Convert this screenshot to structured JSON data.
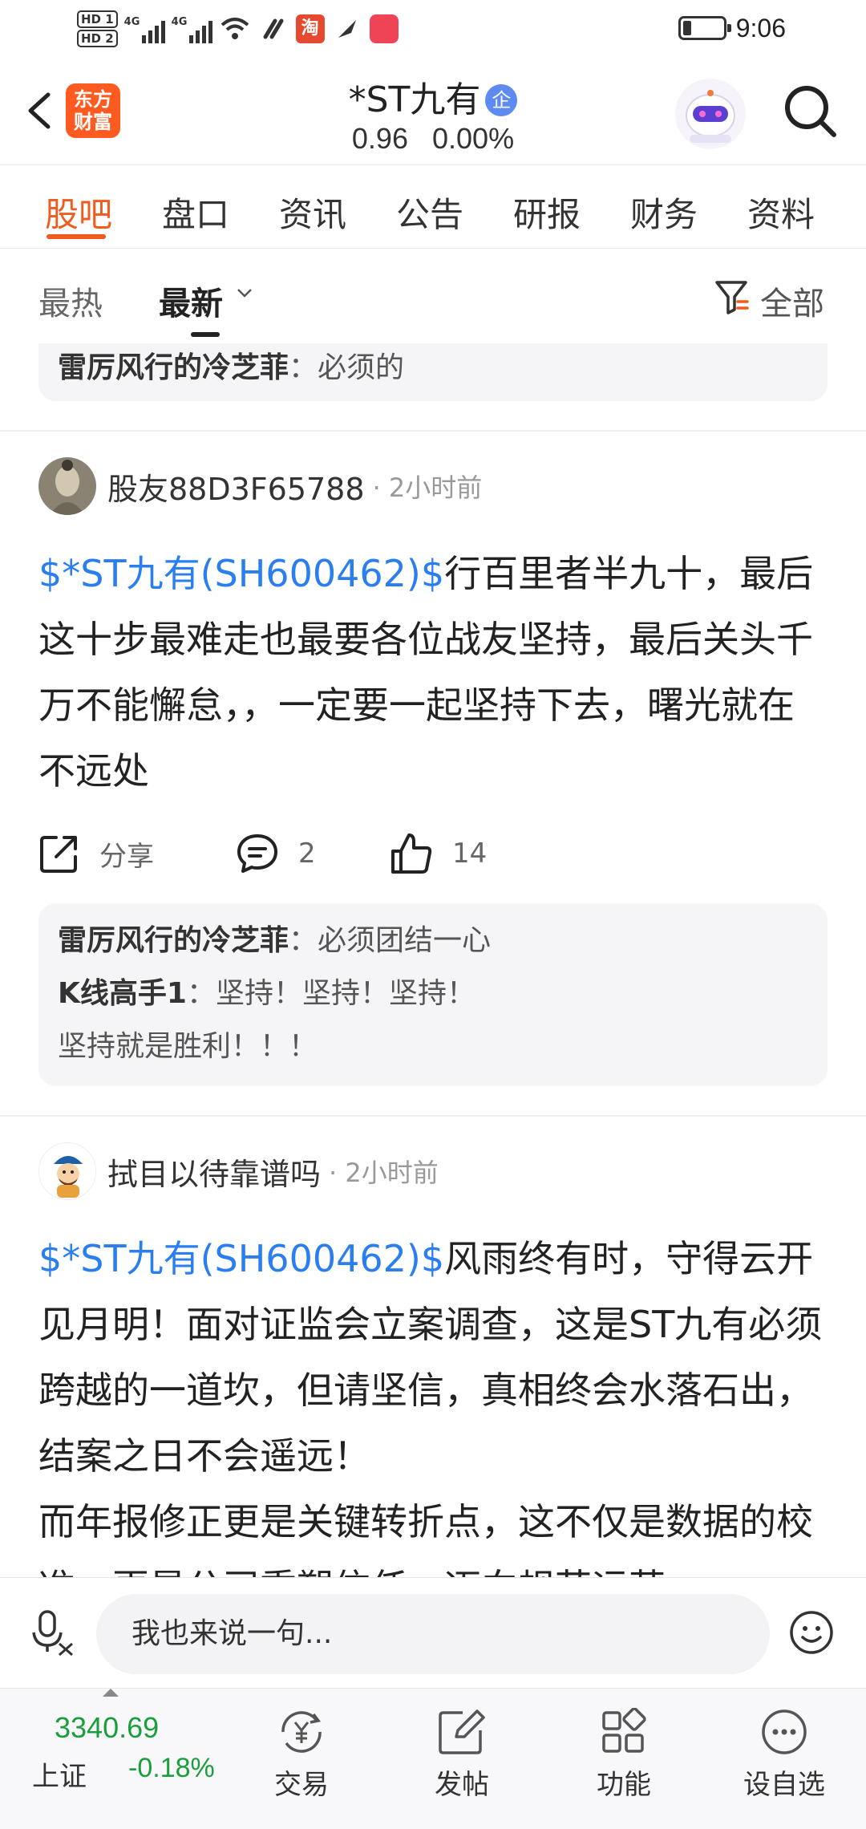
{
  "status_bar": {
    "time": "9:06",
    "hd1": "HD 1",
    "hd2": "HD 2",
    "network1": "4G",
    "network2": "4G",
    "taobao_icon_text": "淘"
  },
  "header": {
    "logo_text_line1": "东方",
    "logo_text_line2": "财富",
    "stock_name": "*ST九有",
    "badge": "企",
    "price": "0.96",
    "change_pct": "0.00%"
  },
  "tabs": [
    {
      "label": "股吧",
      "active": true
    },
    {
      "label": "盘口",
      "active": false
    },
    {
      "label": "资讯",
      "active": false
    },
    {
      "label": "公告",
      "active": false
    },
    {
      "label": "研报",
      "active": false
    },
    {
      "label": "财务",
      "active": false
    },
    {
      "label": "资料",
      "active": false
    }
  ],
  "sort": {
    "hot": "最热",
    "new": "最新",
    "filter_label": "全部"
  },
  "partial_reply": {
    "user": "雷厉风行的冷芝菲",
    "text": "：必须的"
  },
  "posts": [
    {
      "author": "股友88D3F65788",
      "time": "· 2小时前",
      "stock_link": "$*ST九有(SH600462)$",
      "body": "行百里者半九十，最后这十步最难走也最要各位战友坚持，最后关头千万不能懈怠，，一定要一起坚持下去，曙光就在不远处",
      "share_label": "分享",
      "comments": "2",
      "likes": "14",
      "replies": [
        {
          "user": "雷厉风行的冷芝菲",
          "text": "：必须团结一心"
        },
        {
          "user": "K线高手1",
          "text": "：坚持！坚持！坚持！"
        },
        {
          "user": "",
          "text": "坚持就是胜利！！！"
        }
      ]
    },
    {
      "author": "拭目以待靠谱吗",
      "time": "· 2小时前",
      "stock_link": "$*ST九有(SH600462)$",
      "body": "风雨终有时，守得云开见月明！面对证监会立案调查，这是ST九有必须跨越的一道坎，但请坚信，真相终会水落石出，结案之日不会遥远！",
      "body2": "而年报修正更是关键转折点，这不仅是数据的校准，更是公司重塑信任、迈向规范运营"
    }
  ],
  "input": {
    "placeholder": "我也来说一句..."
  },
  "bottom_nav": {
    "index_value": "3340.69",
    "index_name": "上证",
    "index_change": "-0.18%",
    "items": [
      {
        "label": "交易",
        "icon": "yen-exchange-icon"
      },
      {
        "label": "发帖",
        "icon": "edit-post-icon"
      },
      {
        "label": "功能",
        "icon": "grid-function-icon"
      },
      {
        "label": "设自选",
        "icon": "more-dots-icon"
      }
    ]
  },
  "colors": {
    "accent": "#f25a1e",
    "link": "#2a7ef0",
    "index_green": "#1a9e3b"
  }
}
